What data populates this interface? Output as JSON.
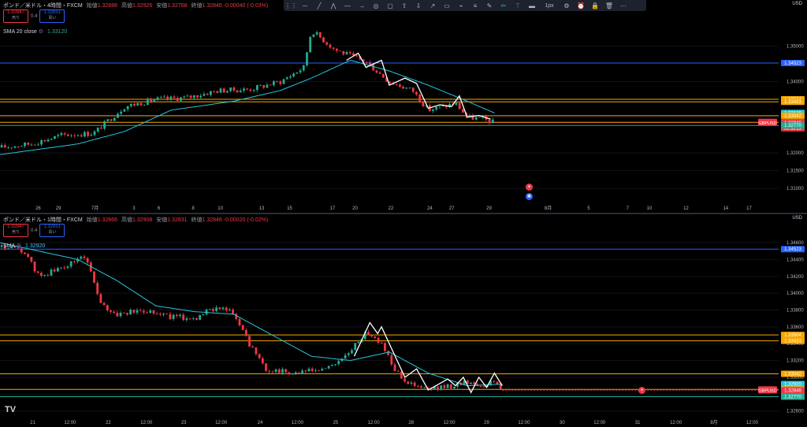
{
  "header_top": {
    "symbol": "ポンド／米ドル・4時間・FXCM",
    "open_label": "始値",
    "open": "1.32886",
    "high_label": "高値",
    "high": "1.32926",
    "low_label": "安値",
    "low": "1.32768",
    "close_label": "終値",
    "close": "1.32846",
    "change": "-0.00040 (-0.03%)",
    "sell_price": "1.32847",
    "sell_label": "売り",
    "spread": "0.4",
    "buy_price": "1.32851",
    "buy_label": "買い",
    "sma_label": "SMA 20 close",
    "sma_value": "1.33120",
    "currency": "USD"
  },
  "header_bottom": {
    "symbol": "ポンド／米ドル・1時間・FXCM",
    "open_label": "始値",
    "open": "1.32866",
    "high_label": "高値",
    "high": "1.32908",
    "low_label": "安値",
    "low": "1.32831",
    "close_label": "終値",
    "close": "1.32846",
    "change": "-0.00020 (-0.02%)",
    "sell_price": "1.32847",
    "sell_label": "売り",
    "spread": "0.4",
    "buy_price": "1.32851",
    "buy_label": "買い",
    "sma_label": "SMA",
    "sma_value": "1.32920",
    "currency": "USD"
  },
  "toolbar": {
    "icons": [
      "drag-handle-icon",
      "horizontal-line-icon",
      "trend-line-icon",
      "fib-icon",
      "line-icon",
      "arrow-right-icon",
      "target-icon",
      "rectangle-icon",
      "arrow-up-icon",
      "arrow-down-icon",
      "arrow-diagonal-icon",
      "comment-icon",
      "path-icon",
      "parallel-icon",
      "brush-icon",
      "pencil-icon",
      "text-tool-icon",
      "line-width-icon",
      "settings-icon",
      "alert-icon",
      "lock-icon",
      "trash-icon",
      "more-icon"
    ],
    "width_label": "1px"
  },
  "chart_data": [
    {
      "type": "candlestick",
      "title": "ポンド／米ドル・4時間・FXCM",
      "ylim": [
        1.3065,
        1.3585
      ],
      "y_ticks": [
        "1.35000",
        "1.34000",
        "1.33000",
        "1.32000",
        "1.31500",
        "1.31000"
      ],
      "y_tick_values": [
        1.35,
        1.34,
        1.33,
        1.32,
        1.315,
        1.31
      ],
      "x_ticks": [
        "26",
        "29",
        "7月",
        "3",
        "6",
        "8",
        "10",
        "13",
        "15",
        "17",
        "20",
        "22",
        "24",
        "27",
        "29",
        "8月",
        "5",
        "7",
        "10",
        "12",
        "14",
        "17"
      ],
      "x_tick_frac": [
        0.049,
        0.075,
        0.122,
        0.172,
        0.204,
        0.248,
        0.283,
        0.336,
        0.372,
        0.427,
        0.456,
        0.502,
        0.552,
        0.58,
        0.628,
        0.704,
        0.756,
        0.806,
        0.834,
        0.881,
        0.932,
        0.962
      ],
      "price_range": {
        "start": 1.3245,
        "end": 1.32846,
        "data_end_frac": 0.635
      },
      "price_path": [
        [
          0,
          1.3215
        ],
        [
          0.04,
          1.3225
        ],
        [
          0.08,
          1.325
        ],
        [
          0.12,
          1.3255
        ],
        [
          0.16,
          1.333
        ],
        [
          0.2,
          1.335
        ],
        [
          0.24,
          1.3355
        ],
        [
          0.28,
          1.3375
        ],
        [
          0.32,
          1.3378
        ],
        [
          0.36,
          1.34
        ],
        [
          0.39,
          1.344
        ],
        [
          0.4,
          1.3545
        ],
        [
          0.43,
          1.349
        ],
        [
          0.47,
          1.3455
        ],
        [
          0.5,
          1.34
        ],
        [
          0.53,
          1.3375
        ],
        [
          0.55,
          1.332
        ],
        [
          0.57,
          1.333
        ],
        [
          0.585,
          1.334
        ],
        [
          0.6,
          1.33
        ],
        [
          0.62,
          1.3295
        ],
        [
          0.635,
          1.32846
        ]
      ],
      "sma_path": [
        [
          0,
          1.3195
        ],
        [
          0.1,
          1.3225
        ],
        [
          0.16,
          1.326
        ],
        [
          0.22,
          1.332
        ],
        [
          0.3,
          1.3345
        ],
        [
          0.36,
          1.3375
        ],
        [
          0.4,
          1.341
        ],
        [
          0.45,
          1.346
        ],
        [
          0.5,
          1.343
        ],
        [
          0.55,
          1.339
        ],
        [
          0.6,
          1.3345
        ],
        [
          0.635,
          1.3312
        ]
      ],
      "zigzag": [
        [
          0.445,
          1.346
        ],
        [
          0.46,
          1.348
        ],
        [
          0.47,
          1.344
        ],
        [
          0.49,
          1.346
        ],
        [
          0.5,
          1.339
        ],
        [
          0.52,
          1.341
        ],
        [
          0.535,
          1.3395
        ],
        [
          0.55,
          1.3325
        ],
        [
          0.565,
          1.3335
        ],
        [
          0.58,
          1.333
        ],
        [
          0.59,
          1.336
        ],
        [
          0.6,
          1.33
        ],
        [
          0.615,
          1.3305
        ],
        [
          0.63,
          1.3295
        ]
      ],
      "hlines": [
        {
          "value": 1.34523,
          "label": "1.34523",
          "color": "#2962ff"
        },
        {
          "value": 1.33504,
          "label": "1.33504",
          "color": "#f7a600"
        },
        {
          "value": 1.33433,
          "label": "1.33433",
          "color": "#f7a600"
        },
        {
          "value": 1.33042,
          "label": "1.33042",
          "color": "#f7a600"
        },
        {
          "value": 1.32857,
          "label": "1.32857",
          "color": "#f7a600"
        },
        {
          "value": 1.3277,
          "label": "1.32770",
          "color": "#22ab94"
        }
      ],
      "price_tags": [
        {
          "value": 1.34523,
          "label": "1.34523",
          "color": "#2962ff"
        },
        {
          "value": 1.33504,
          "label": "1.33504",
          "color": "#f7a600"
        },
        {
          "value": 1.33433,
          "label": "1.33433",
          "color": "#f7a600"
        },
        {
          "value": 1.3312,
          "label": "1.33120",
          "color": "#26c6da"
        },
        {
          "value": 1.33042,
          "label": "1.33042",
          "color": "#f7a600"
        },
        {
          "value": 1.32857,
          "label": "1.32857",
          "color": "#f7a600"
        },
        {
          "value": 1.32846,
          "label": "1.32846",
          "color": "#f23645",
          "sub": "02:30:29"
        },
        {
          "value": 1.3277,
          "label": "1.32770",
          "color": "#22ab94"
        }
      ],
      "last_price_tag": "GBPUSD"
    },
    {
      "type": "candlestick",
      "title": "ポンド／米ドル・1時間・FXCM",
      "ylim": [
        1.3255,
        1.3475
      ],
      "y_ticks": [
        "1.34600",
        "1.34400",
        "1.34200",
        "1.34000",
        "1.33800",
        "1.33600",
        "1.33400",
        "1.33200",
        "1.33000",
        "1.32800",
        "1.32600"
      ],
      "y_tick_values": [
        1.346,
        1.344,
        1.342,
        1.34,
        1.338,
        1.336,
        1.334,
        1.332,
        1.33,
        1.328,
        1.326
      ],
      "x_ticks": [
        "21",
        "12:00",
        "22",
        "12:00",
        "23",
        "12:00",
        "24",
        "12:00",
        "25",
        "12:00",
        "28",
        "12:00",
        "29",
        "12:00",
        "30",
        "12:00",
        "31",
        "12:00",
        "8月",
        "12:00"
      ],
      "x_tick_frac": [
        0.042,
        0.09,
        0.139,
        0.188,
        0.236,
        0.284,
        0.334,
        0.382,
        0.431,
        0.48,
        0.528,
        0.577,
        0.625,
        0.673,
        0.722,
        0.77,
        0.819,
        0.868,
        0.917,
        0.966
      ],
      "price_range": {
        "start": 1.345,
        "end": 1.32846,
        "data_end_frac": 0.645
      },
      "price_path": [
        [
          0,
          1.3455
        ],
        [
          0.03,
          1.345
        ],
        [
          0.05,
          1.342
        ],
        [
          0.08,
          1.343
        ],
        [
          0.11,
          1.3445
        ],
        [
          0.13,
          1.3385
        ],
        [
          0.15,
          1.3375
        ],
        [
          0.19,
          1.338
        ],
        [
          0.22,
          1.3372
        ],
        [
          0.25,
          1.337
        ],
        [
          0.28,
          1.3385
        ],
        [
          0.3,
          1.3375
        ],
        [
          0.32,
          1.334
        ],
        [
          0.34,
          1.331
        ],
        [
          0.38,
          1.3305
        ],
        [
          0.42,
          1.331
        ],
        [
          0.45,
          1.333
        ],
        [
          0.47,
          1.3355
        ],
        [
          0.49,
          1.334
        ],
        [
          0.51,
          1.3305
        ],
        [
          0.53,
          1.329
        ],
        [
          0.55,
          1.3285
        ],
        [
          0.58,
          1.329
        ],
        [
          0.6,
          1.3295
        ],
        [
          0.62,
          1.329
        ],
        [
          0.635,
          1.3295
        ],
        [
          0.645,
          1.32846
        ]
      ],
      "sma_path": [
        [
          0,
          1.346
        ],
        [
          0.05,
          1.345
        ],
        [
          0.1,
          1.344
        ],
        [
          0.15,
          1.3415
        ],
        [
          0.2,
          1.3385
        ],
        [
          0.25,
          1.3378
        ],
        [
          0.3,
          1.3375
        ],
        [
          0.35,
          1.335
        ],
        [
          0.4,
          1.3325
        ],
        [
          0.45,
          1.332
        ],
        [
          0.5,
          1.333
        ],
        [
          0.55,
          1.3305
        ],
        [
          0.6,
          1.329
        ],
        [
          0.645,
          1.3292
        ]
      ],
      "zigzag": [
        [
          0.455,
          1.3325
        ],
        [
          0.475,
          1.3365
        ],
        [
          0.485,
          1.3352
        ],
        [
          0.49,
          1.336
        ],
        [
          0.51,
          1.332
        ],
        [
          0.52,
          1.33
        ],
        [
          0.535,
          1.331
        ],
        [
          0.55,
          1.3285
        ],
        [
          0.56,
          1.329
        ],
        [
          0.575,
          1.3298
        ],
        [
          0.585,
          1.329
        ],
        [
          0.595,
          1.33
        ],
        [
          0.605,
          1.3282
        ],
        [
          0.615,
          1.33
        ],
        [
          0.625,
          1.3288
        ],
        [
          0.635,
          1.3305
        ],
        [
          0.645,
          1.329
        ]
      ],
      "hlines": [
        {
          "value": 1.34523,
          "label": "1.34523",
          "color": "#2962ff"
        },
        {
          "value": 1.33504,
          "label": "1.33504",
          "color": "#f7a600"
        },
        {
          "value": 1.33433,
          "label": "1.33433",
          "color": "#f7a600"
        },
        {
          "value": 1.33042,
          "label": "1.33042",
          "color": "#f7a600"
        },
        {
          "value": 1.32857,
          "label": "1.32857",
          "color": "#f7a600"
        },
        {
          "value": 1.3277,
          "label": "1.32770",
          "color": "#22ab94"
        }
      ],
      "price_tags": [
        {
          "value": 1.34523,
          "label": "1.34523",
          "color": "#2962ff"
        },
        {
          "value": 1.33504,
          "label": "1.33504",
          "color": "#f7a600"
        },
        {
          "value": 1.33433,
          "label": "1.33433",
          "color": "#f7a600"
        },
        {
          "value": 1.33042,
          "label": "1.33042",
          "color": "#f7a600"
        },
        {
          "value": 1.3292,
          "label": "1.32920",
          "color": "#26c6da"
        },
        {
          "value": 1.32857,
          "label": "1.32857",
          "color": "#f7a600"
        },
        {
          "value": 1.32846,
          "label": "1.32846",
          "color": "#f23645",
          "sub": "30:29"
        },
        {
          "value": 1.3277,
          "label": "1.32770",
          "color": "#22ab94"
        }
      ],
      "last_price_tag": "GBPUSD"
    }
  ]
}
